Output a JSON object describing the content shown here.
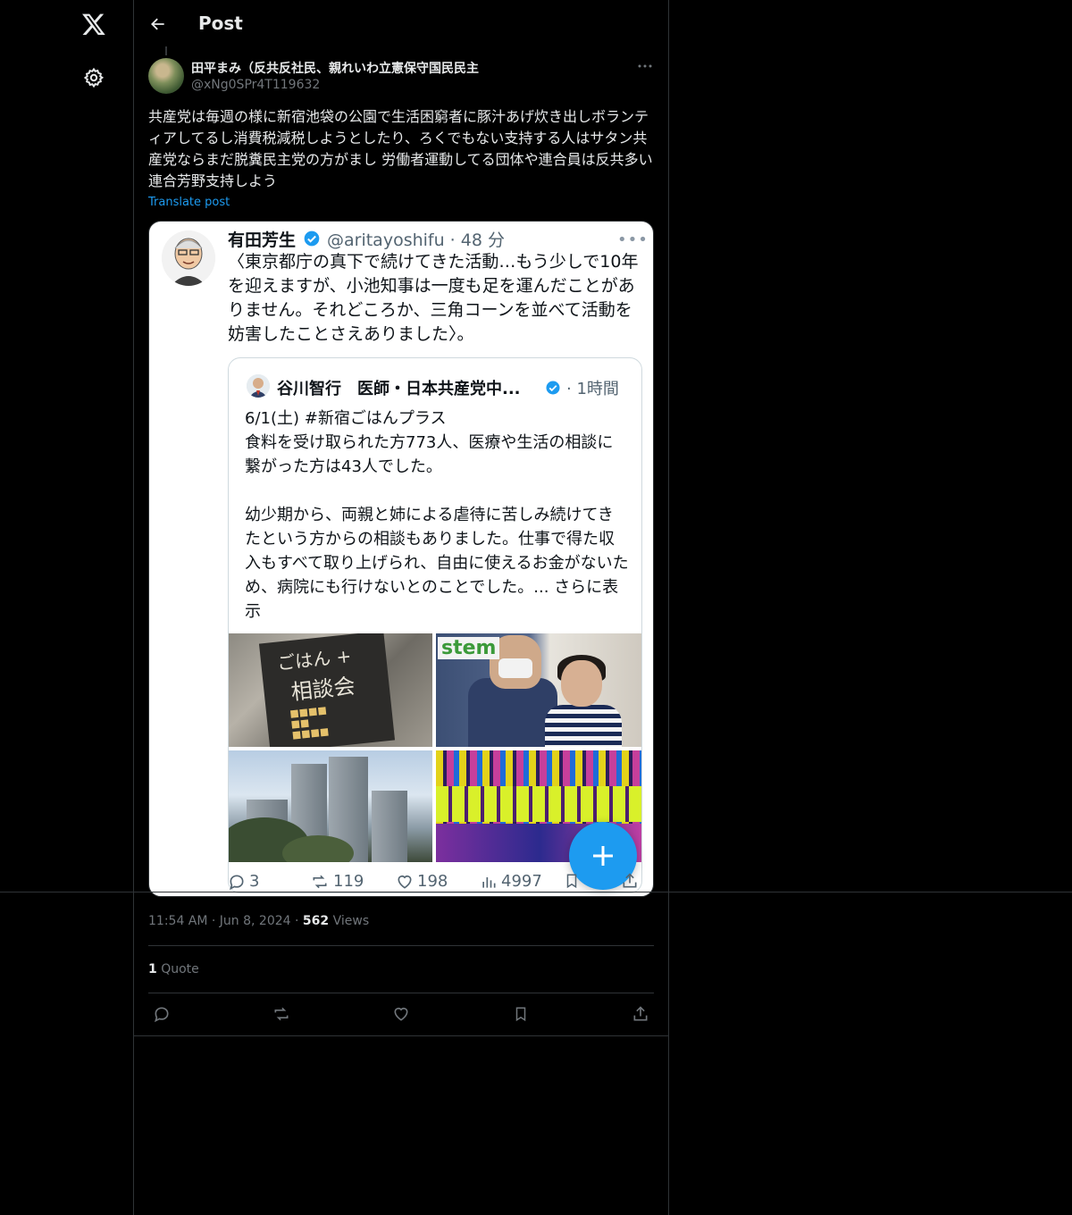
{
  "header": {
    "title": "Post"
  },
  "post": {
    "author_name": "田平まみ（反共反社民、親れいわ立憲保守国民民主",
    "author_handle": "@xNg0SPr4T119632",
    "text": "共産党は毎週の様に新宿池袋の公園で生活困窮者に豚汁あげ炊き出しボランティアしてるし消費税減税しようとしたり、ろくでもない支持する人はサタン共産党ならまだ脱糞民主党の方がまし 労働者運動してる団体や連合員は反共多い 連合芳野支持しよう",
    "translate_label": "Translate post",
    "time": "11:54 AM · Jun 8, 2024 · ",
    "views_count": "562",
    "views_label": " Views",
    "quote_count": "1",
    "quote_label": " Quote"
  },
  "embedded": {
    "name": "有田芳生",
    "handle_time": "@aritayoshifu · 48 分",
    "text": "〈東京都庁の真下で続けてきた活動…もう少しで10年を迎えますが、小池知事は一度も足を運んだことがありません。それどころか、三角コーンを並べて活動を妨害したことさえありました〉。",
    "inner": {
      "name": "谷川智行　医師・日本共産党中...",
      "time": "· 1時間",
      "line1": "6/1(土) #新宿ごはんプラス",
      "line2": "食料を受け取られた方773人、医療や生活の相談に繋がった方は43人でした。",
      "line3": "幼少期から、両親と姉による虐待に苦しみ続けてきたという方からの相談もありました。仕事で得た収入もすべて取り上げられ、自由に使えるお金がないため、病院にも行けないとのことでした。... ",
      "more": "さらに表示",
      "photo1_text": [
        "ごはん +",
        "相談会"
      ],
      "photo2_text": "stem"
    },
    "actions": {
      "replies": "3",
      "reposts": "119",
      "likes": "198",
      "views": "4997"
    }
  },
  "colors": {
    "accent": "#1d9bf0",
    "background": "#000000",
    "border": "#2f3336",
    "muted": "#71767b"
  }
}
